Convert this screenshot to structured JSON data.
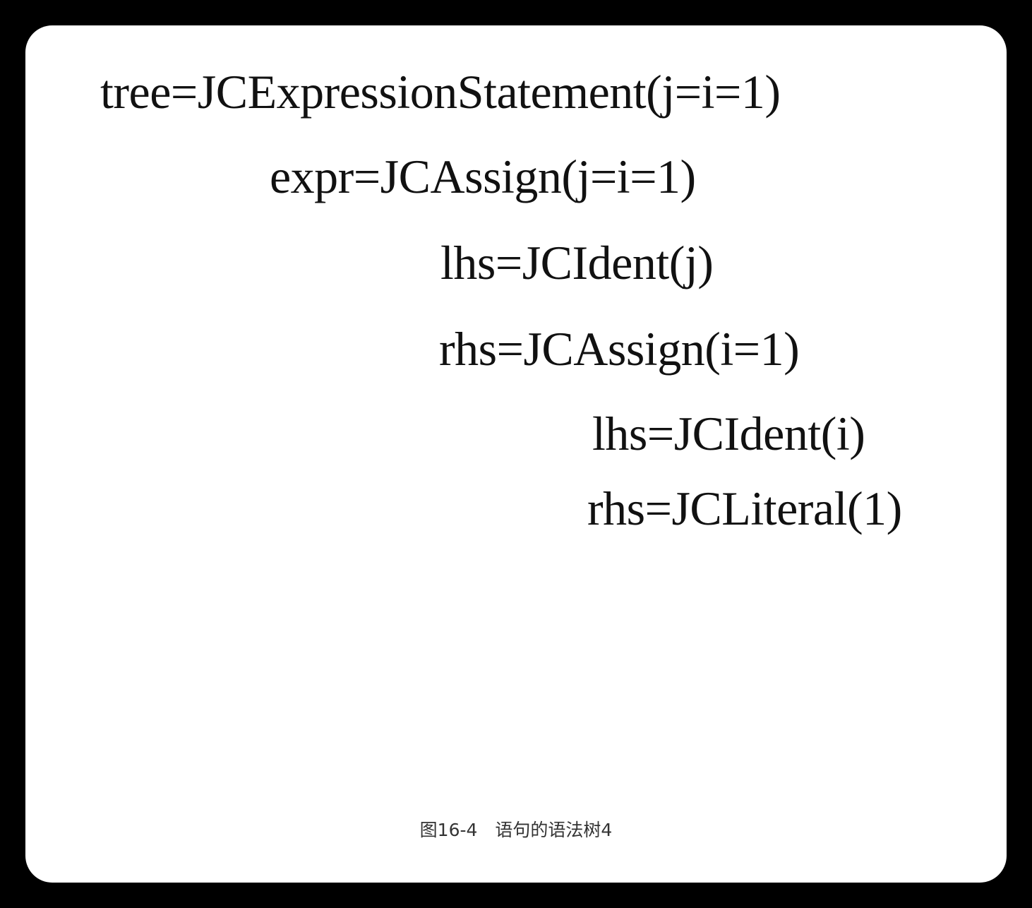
{
  "tree": {
    "root": "tree=JCExpressionStatement(j=i=1)",
    "expr": "expr=JCAssign(j=i=1)",
    "expr_lhs": "lhs=JCIdent(j)",
    "expr_rhs": "rhs=JCAssign(i=1)",
    "inner_lhs": "lhs=JCIdent(i)",
    "inner_rhs": "rhs=JCLiteral(1)"
  },
  "caption": "图16-4　语句的语法树4"
}
